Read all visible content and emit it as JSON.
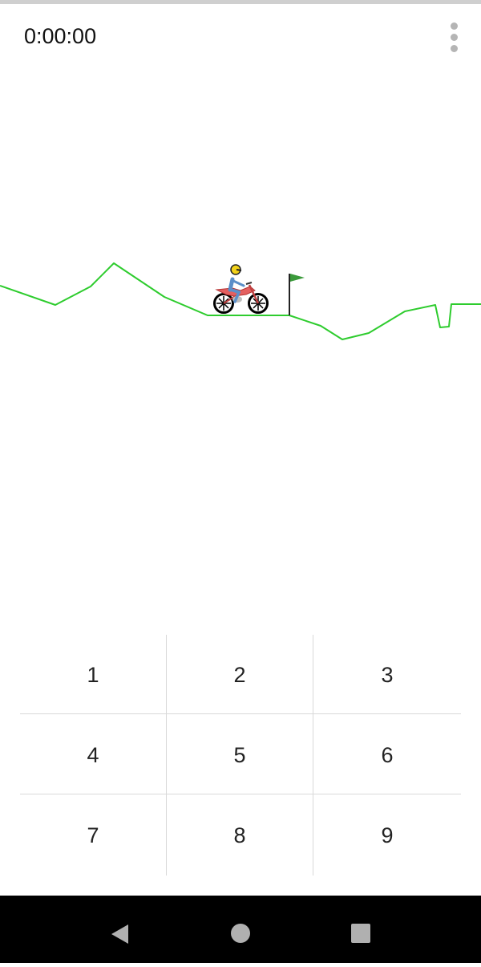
{
  "timer": {
    "value": "0:00:00"
  },
  "menu": {
    "icon": "more-vert-icon"
  },
  "colors": {
    "terrain": "#2ecc2e",
    "flag": "#3b9a3b",
    "bike": "#d84848",
    "rider_shirt": "#5b8fc9",
    "helmet": "#f2d21b",
    "wheel": "#000000",
    "keypad_divider": "#d9d9d9",
    "navbar": "#000000",
    "nav_icon": "#b0b0b0"
  },
  "keypad": {
    "keys": [
      {
        "label": "1"
      },
      {
        "label": "2"
      },
      {
        "label": "3"
      },
      {
        "label": "4"
      },
      {
        "label": "5"
      },
      {
        "label": "6"
      },
      {
        "label": "7"
      },
      {
        "label": "8"
      },
      {
        "label": "9"
      }
    ]
  },
  "navbar": {
    "buttons": [
      {
        "icon": "back-triangle-icon"
      },
      {
        "icon": "home-circle-icon"
      },
      {
        "icon": "recents-square-icon"
      }
    ]
  }
}
